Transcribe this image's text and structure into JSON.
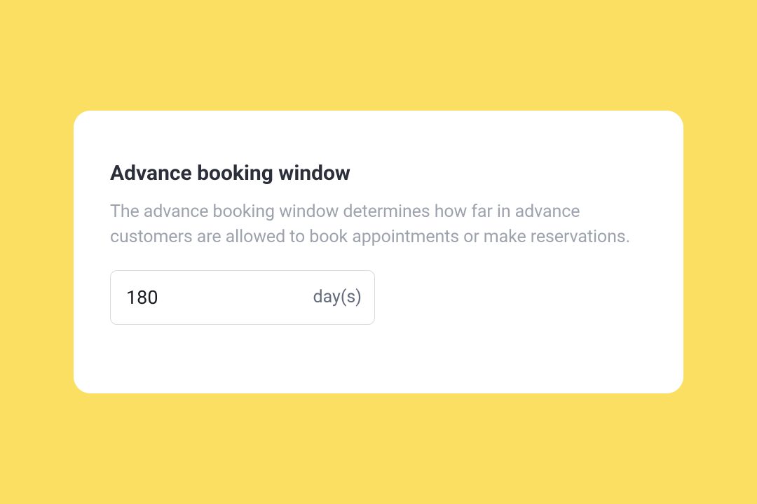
{
  "card": {
    "heading": "Advance booking window",
    "description": "The advance booking window determines how far in advance customers are allowed to book appointments or make reservations.",
    "input": {
      "value": "180",
      "suffix": "day(s)"
    }
  }
}
